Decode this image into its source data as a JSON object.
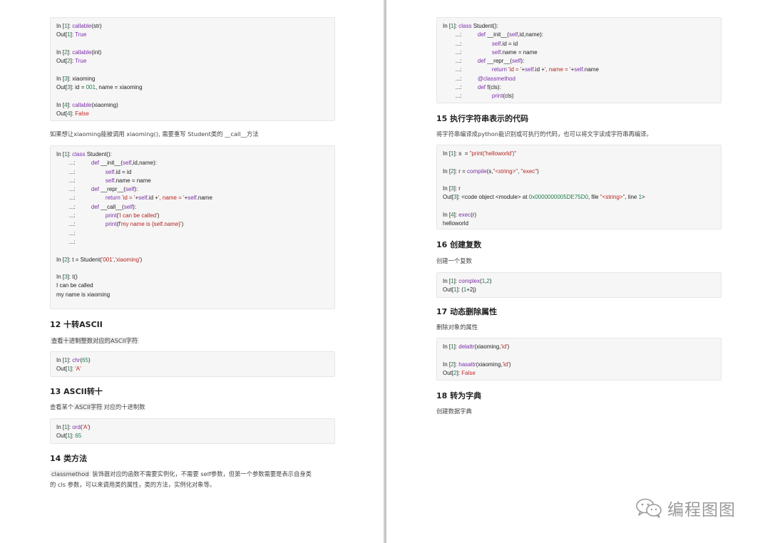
{
  "left": {
    "block1": [
      "In [1]: callable(str)",
      "Out[1]: True",
      "",
      "In [2]: callable(int)",
      "Out[2]: True",
      "",
      "In [3]: xiaoming",
      "Out[3]: id = 001, name = xiaoming",
      "",
      "In [4]: callable(xiaoming)",
      "Out[4]: False"
    ],
    "para1_pre": "如果想让",
    "para1_code1": "xiaoming",
    "para1_mid": "能被调用 xiaoming(), 需要重写 Student类的 __call__方法",
    "block2": [
      "In [1]: class Student():",
      "        ...:          def __init__(self,id,name):",
      "        ...:                   self.id = id",
      "        ...:                   self.name = name",
      "        ...:          def __repr__(self):",
      "        ...:                   return 'id = '+self.id +', name = '+self.name",
      "        ...:          def __call__(self):",
      "        ...:                   print('I can be called')",
      "        ...:                   print(f'my name is {self.name}')",
      "        ...:",
      "        ...:",
      "",
      "In [2]: t = Student('001','xiaoming')",
      "",
      "In [3]: t()",
      "I can be called",
      "my name is xiaoming"
    ],
    "h12": "12  十转ASCII",
    "p12": "查看十进制整数对应的ASCII字符",
    "block3": [
      "In [1]: chr(65)",
      "Out[1]: 'A'"
    ],
    "h13": "13  ASCII转十",
    "p13_pre": "查看某个",
    "p13_code": "ASCII字符",
    "p13_post": "对应的十进制数",
    "block4": [
      "In [1]: ord('A')",
      "Out[1]: 65"
    ],
    "h14": "14  类方法",
    "p14_code": "classmethod",
    "p14_line1": " 装饰器对应的函数不需要实例化，不需要 self参数，但第一个参数需要是表示自身类",
    "p14_line2": "的 cls 参数，可以来调用类的属性，类的方法，实例化对象等。"
  },
  "right": {
    "block5": [
      "In [1]: class Student():",
      "        ...:          def __init__(self,id,name):",
      "        ...:                   self.id = id",
      "        ...:                   self.name = name",
      "        ...:          def __repr__(self):",
      "        ...:                   return 'id = '+self.id +', name = '+self.name",
      "        ...:          @classmethod",
      "        ...:          def f(cls):",
      "        ...:                   print(cls)"
    ],
    "h15": "15  执行字符串表示的代码",
    "p15": "将字符串编译成python能识别或可执行的代码，也可以将文字读成字符串再编译。",
    "block6": [
      "In [1]: s  = \"print('helloworld')\"",
      "",
      "In [2]: r = compile(s,\"<string>\", \"exec\")",
      "",
      "In [3]: r",
      "Out[3]: <code object <module> at 0x0000000005DE75D0, file \"<string>\", line 1>",
      "",
      "In [4]: exec(r)",
      "helloworld"
    ],
    "h16": "16  创建复数",
    "p16": "创建一个复数",
    "block7": [
      "In [1]: complex(1,2)",
      "Out[1]: (1+2j)"
    ],
    "h17": "17  动态删除属性",
    "p17": "删除对象的属性",
    "block8": [
      "In [1]: delattr(xiaoming,'id')",
      "",
      "In [2]: hasattr(xiaoming,'id')",
      "Out[2]: False"
    ],
    "h18": "18  转为字典",
    "p18": "创建数据字典"
  },
  "watermark": {
    "text": "编程图图",
    "icon": "wechat-icon"
  },
  "colors": {
    "keyword": "#7a2ea8",
    "number": "#1d7f4a",
    "string": "#b3261e",
    "false": "#c62828"
  }
}
